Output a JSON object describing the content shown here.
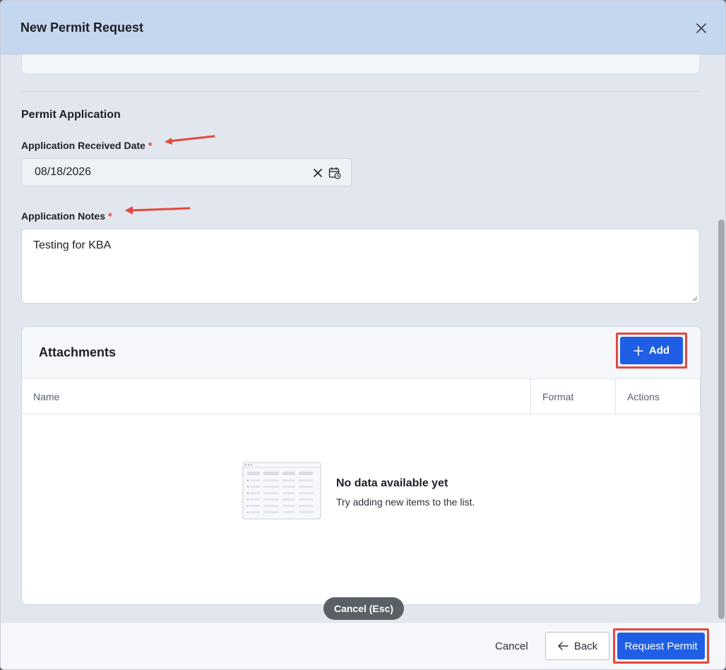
{
  "modal": {
    "title": "New Permit Request"
  },
  "permit_application": {
    "section_title": "Permit Application",
    "received_date": {
      "label": "Application Received Date",
      "required_mark": "*",
      "value": "08/18/2026"
    },
    "notes": {
      "label": "Application Notes",
      "required_mark": "*",
      "value": "Testing for KBA"
    }
  },
  "attachments": {
    "title": "Attachments",
    "add_label": "Add",
    "columns": [
      "Name",
      "Format",
      "Actions"
    ],
    "empty_title": "No data available yet",
    "empty_subtitle": "Try adding new items to the list."
  },
  "tooltip": {
    "text": "Cancel (Esc)"
  },
  "footer": {
    "cancel_label": "Cancel",
    "back_label": "Back",
    "submit_label": "Request Permit"
  },
  "colors": {
    "header_bg": "#c5d6ef",
    "primary": "#1f5fe6",
    "highlight": "#e5483f",
    "required": "#e0463b"
  },
  "icons": {
    "close": "close-icon",
    "clear": "clear-icon",
    "calendar": "calendar-icon",
    "plus": "plus-icon",
    "arrow_left": "arrow-left-icon"
  }
}
